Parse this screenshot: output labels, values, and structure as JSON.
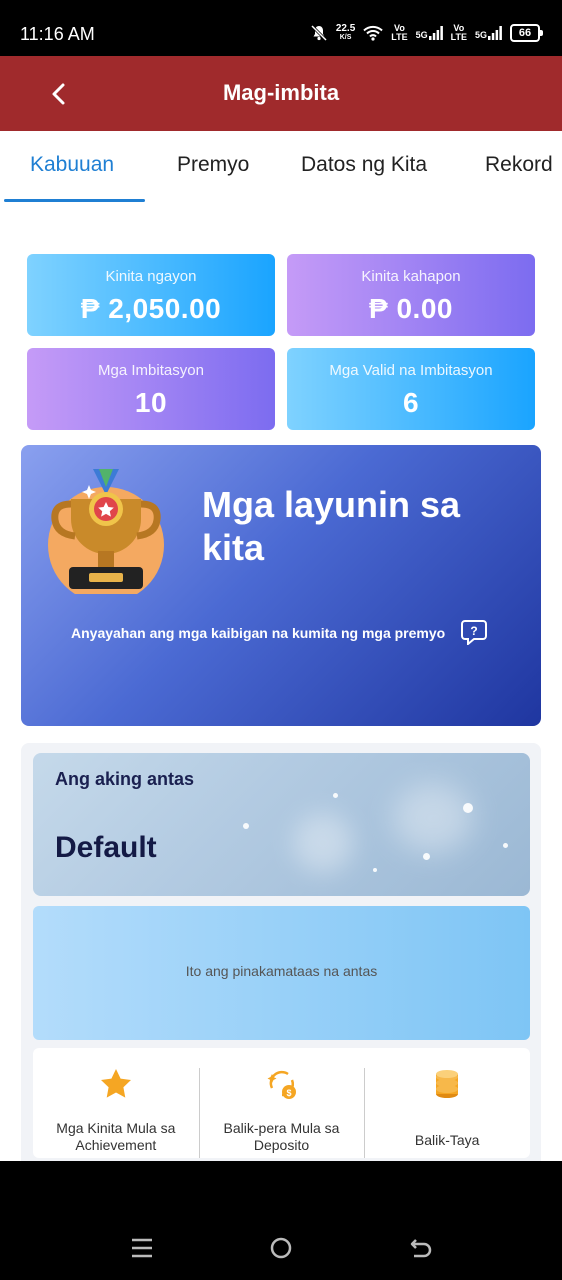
{
  "status": {
    "time": "11:16 AM",
    "speed": "22.5",
    "speed_unit": "K/S",
    "net1_vo": "Vo",
    "net1_lte": "LTE",
    "net1_5g": "5G",
    "net2_vo": "Vo",
    "net2_lte": "LTE",
    "net2_5g": "5G",
    "battery": "66"
  },
  "appbar": {
    "title": "Mag-imbita"
  },
  "tabs": [
    {
      "label": "Kabuuan",
      "active": true
    },
    {
      "label": "Premyo"
    },
    {
      "label": "Datos ng Kita"
    },
    {
      "label": "Rekord"
    }
  ],
  "stats": {
    "today": {
      "label": "Kinita ngayon",
      "value": "₱ 2,050.00"
    },
    "yesterday": {
      "label": "Kinita kahapon",
      "value": "₱ 0.00"
    },
    "invites": {
      "label": "Mga Imbitasyon",
      "value": "10"
    },
    "valid_invites": {
      "label": "Mga Valid na Imbitasyon",
      "value": "6"
    }
  },
  "goals": {
    "title": "Mga layunin sa kita",
    "subtitle": "Anyayahan ang mga kaibigan na kumita ng mga premyo"
  },
  "level": {
    "label": "Ang aking antas",
    "value": "Default",
    "highest_note": "Ito ang pinakamataas na antas"
  },
  "features": [
    {
      "icon": "star-icon",
      "label": "Mga Kinita Mula sa Achievement"
    },
    {
      "icon": "cashback-icon",
      "label": "Balik-pera Mula sa Deposito"
    },
    {
      "icon": "coins-icon",
      "label": "Balik-Taya"
    }
  ],
  "colors": {
    "appbar": "#a02a2c",
    "tab_active": "#1f7fd3",
    "card_blue": "#1aa4ff",
    "card_purple": "#7c6cf0"
  }
}
